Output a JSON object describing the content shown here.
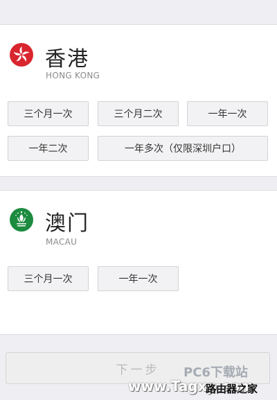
{
  "regions": [
    {
      "name": "香港",
      "name_en": "HONG KONG",
      "flag_icon": "hong-kong-flag-icon",
      "flag_color": "#d9262e",
      "options": [
        "三个月一次",
        "三个月二次",
        "一年一次",
        "一年二次",
        "一年多次（仅限深圳户口）"
      ]
    },
    {
      "name": "澳门",
      "name_en": "MACAU",
      "flag_icon": "macau-flag-icon",
      "flag_color": "#1c8b3f",
      "options": [
        "三个月一次",
        "一年一次"
      ]
    }
  ],
  "footer": {
    "next_label": "下一步"
  },
  "watermark": {
    "line1": "PC6下载站",
    "line2": "www.Tagxp.com",
    "line3": "路由器之家"
  }
}
